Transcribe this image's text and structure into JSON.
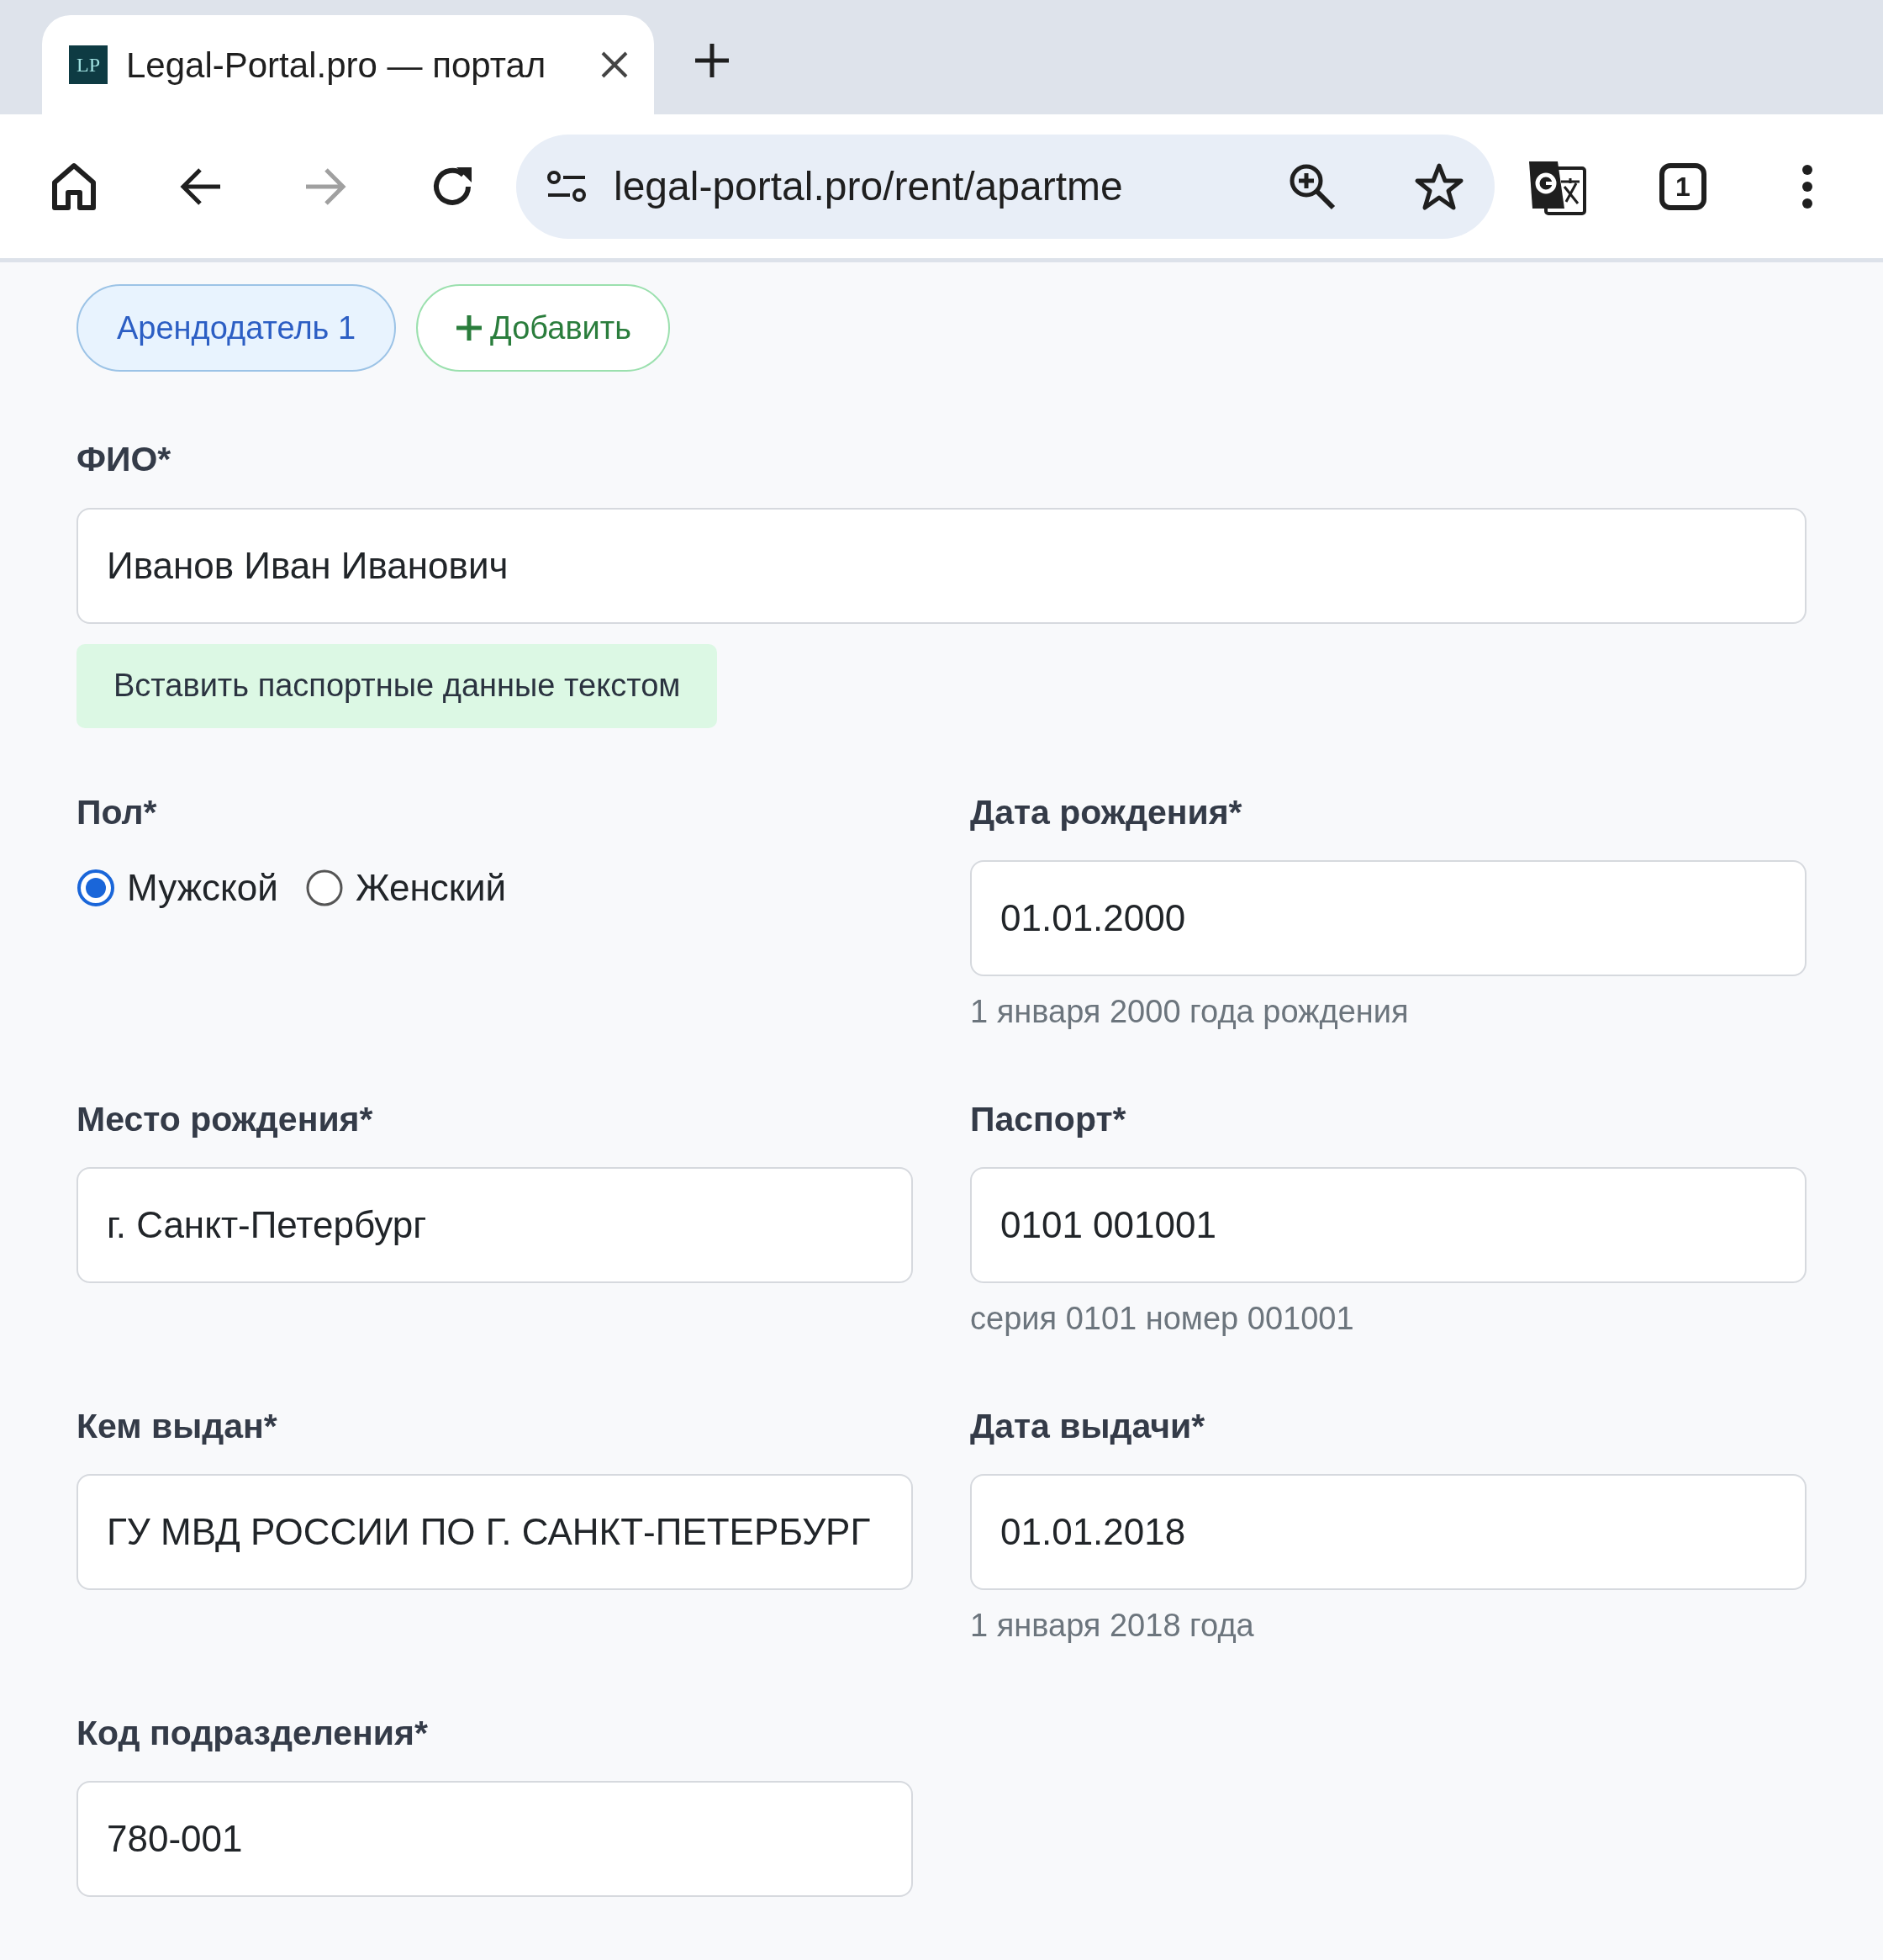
{
  "browser": {
    "tab": {
      "favicon_text": "LP",
      "title": "Legal-Portal.pro — портал",
      "selected": true
    },
    "url": "legal-portal.pro/rent/apartme",
    "tab_count": "1",
    "forward_disabled": true
  },
  "landlords": {
    "pills": [
      {
        "label": "Арендодатель 1",
        "selected": true
      }
    ],
    "add_label": "Добавить"
  },
  "full_name": {
    "label": "ФИО*",
    "value": "Иванов Иван Иванович"
  },
  "paste_button": "Вставить паспортные данные текстом",
  "fields": [
    {
      "kind": "radio",
      "label": "Пол*",
      "options": [
        {
          "label": "Мужской",
          "selected": true
        },
        {
          "label": "Женский",
          "selected": false
        }
      ]
    },
    {
      "kind": "text",
      "label": "Дата рождения*",
      "value": "01.01.2000",
      "hint": "1 января 2000 года рождения"
    },
    {
      "kind": "text",
      "label": "Место рождения*",
      "value": "г. Санкт-Петербург"
    },
    {
      "kind": "text",
      "label": "Паспорт*",
      "value": "0101 001001",
      "hint": "серия 0101 номер 001001"
    },
    {
      "kind": "text",
      "label": "Кем выдан*",
      "value": "ГУ МВД РОССИИ ПО Г. САНКТ-ПЕТЕРБУРГ"
    },
    {
      "kind": "text",
      "label": "Дата выдачи*",
      "value": "01.01.2018",
      "hint": "1 января 2018 года"
    },
    {
      "kind": "text",
      "label": "Код подразделения*",
      "value": "780-001"
    }
  ]
}
